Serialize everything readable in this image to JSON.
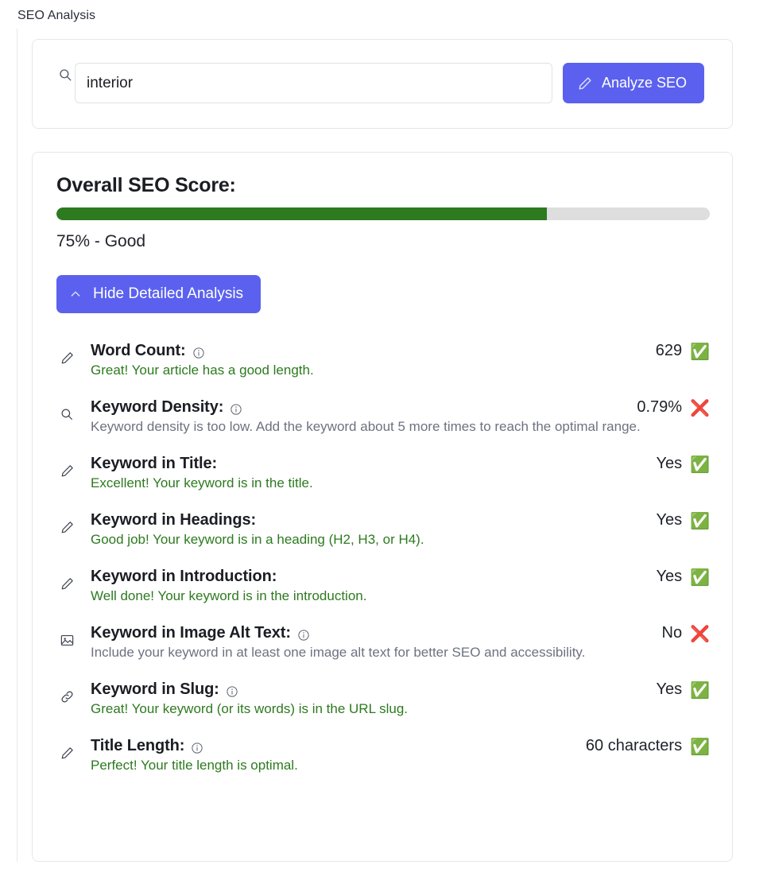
{
  "page": {
    "title": "SEO Analysis"
  },
  "search": {
    "input_value": "interior",
    "input_placeholder": "",
    "search_icon": "search-icon",
    "analyze_button": {
      "label": "Analyze SEO",
      "icon": "pencil-icon",
      "color": "#5b61ee"
    }
  },
  "score": {
    "heading": "Overall SEO Score:",
    "percent": 75,
    "label": "75% - Good",
    "bar_fill_color": "#2d7a1f",
    "bar_track_color": "#dededf",
    "toggle_button": {
      "label": "Hide Detailed Analysis",
      "icon": "chevron-up-icon",
      "color": "#5b61ee"
    }
  },
  "metrics": [
    {
      "icon": "pencil-icon",
      "name": "Word Count:",
      "has_info": true,
      "value": "629",
      "status": "pass",
      "status_emoji": "✅",
      "description": "Great! Your article has a good length."
    },
    {
      "icon": "search-icon",
      "name": "Keyword Density:",
      "has_info": true,
      "value": "0.79%",
      "status": "fail",
      "status_emoji": "❌",
      "description": "Keyword density is too low. Add the keyword about 5 more times to reach the optimal range."
    },
    {
      "icon": "pencil-icon",
      "name": "Keyword in Title:",
      "has_info": false,
      "value": "Yes",
      "status": "pass",
      "status_emoji": "✅",
      "description": "Excellent! Your keyword is in the title."
    },
    {
      "icon": "pencil-icon",
      "name": "Keyword in Headings:",
      "has_info": false,
      "value": "Yes",
      "status": "pass",
      "status_emoji": "✅",
      "description": "Good job! Your keyword is in a heading (H2, H3, or H4)."
    },
    {
      "icon": "pencil-icon",
      "name": "Keyword in Introduction:",
      "has_info": false,
      "value": "Yes",
      "status": "pass",
      "status_emoji": "✅",
      "description": "Well done! Your keyword is in the introduction."
    },
    {
      "icon": "image-icon",
      "name": "Keyword in Image Alt Text:",
      "has_info": true,
      "value": "No",
      "status": "fail",
      "status_emoji": "❌",
      "description": "Include your keyword in at least one image alt text for better SEO and accessibility."
    },
    {
      "icon": "link-icon",
      "name": "Keyword in Slug:",
      "has_info": true,
      "value": "Yes",
      "status": "pass",
      "status_emoji": "✅",
      "description": "Great! Your keyword (or its words) is in the URL slug."
    },
    {
      "icon": "pencil-icon",
      "name": "Title Length:",
      "has_info": true,
      "value": "60 characters",
      "status": "pass",
      "status_emoji": "✅",
      "description": "Perfect! Your title length is optimal."
    }
  ]
}
